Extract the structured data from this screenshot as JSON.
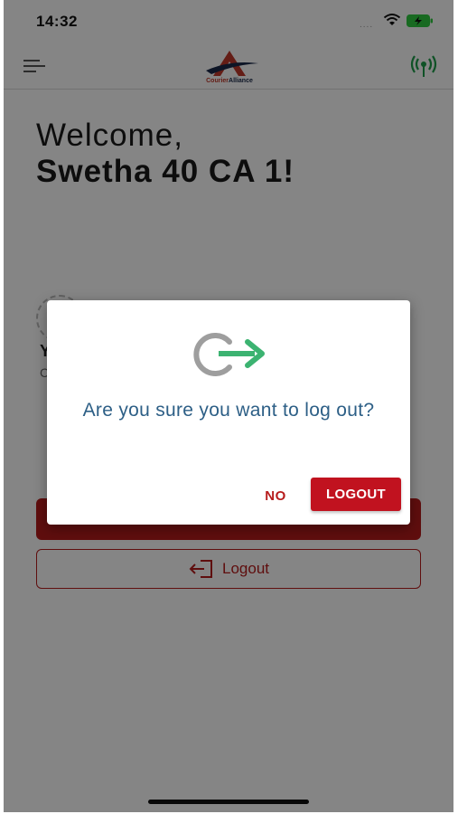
{
  "status_bar": {
    "time": "14:32",
    "signal": "....",
    "wifi_icon": "wifi-icon",
    "battery_icon": "battery-charging-icon",
    "battery_color": "#2ecc40"
  },
  "nav": {
    "menu_icon": "hamburger-menu-icon",
    "logo_text_part1": "Courier",
    "logo_text_part2": "Alliance",
    "broadcast_icon": "broadcast-signal-icon",
    "broadcast_color": "#1e9e4a"
  },
  "main": {
    "welcome": "Welcome,",
    "user_name": "Swetha 40 CA 1!",
    "partial_letter": "Y",
    "partial_letter2": "C",
    "logout_label": "Logout",
    "logout_icon": "logout-arrow-icon"
  },
  "dialog": {
    "icon": "power-logout-icon",
    "message": "Are you sure you want to log out?",
    "no_label": "NO",
    "logout_label": "LOGOUT"
  },
  "colors": {
    "accent": "#b71c1c",
    "message_text": "#2d5f86",
    "icon_arrow": "#3cb371",
    "icon_ring": "#9e9e9e"
  }
}
